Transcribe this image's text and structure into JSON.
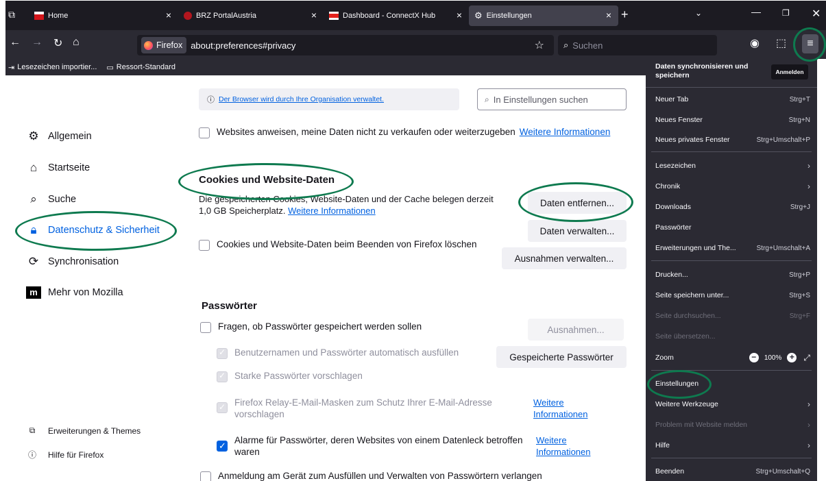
{
  "tabs": [
    {
      "title": "Home",
      "favicon_color": "#d4151a"
    },
    {
      "title": "BRZ PortalAustria",
      "favicon_color": "#b2161e"
    },
    {
      "title": "Dashboard - ConnectX Hub",
      "favicon_color": "#e2211c"
    },
    {
      "title": "Einstellungen",
      "favicon": "gear-icon",
      "active": true
    }
  ],
  "urlbar": {
    "identity": "Firefox",
    "url": "about:preferences#privacy"
  },
  "search": {
    "placeholder": "Suchen"
  },
  "bookmarks": [
    {
      "label": "Lesezeichen importier...",
      "icon": "import-icon"
    },
    {
      "label": "Ressort-Standard",
      "icon": "folder-icon"
    }
  ],
  "sidebar": {
    "items": [
      {
        "label": "Allgemein",
        "icon": "gear-icon"
      },
      {
        "label": "Startseite",
        "icon": "home-icon"
      },
      {
        "label": "Suche",
        "icon": "search-icon"
      },
      {
        "label": "Datenschutz & Sicherheit",
        "icon": "lock-icon",
        "selected": true
      },
      {
        "label": "Synchronisation",
        "icon": "sync-icon"
      },
      {
        "label": "Mehr von Mozilla",
        "icon": "mozilla-icon"
      }
    ],
    "footer": [
      {
        "label": "Erweiterungen & Themes",
        "icon": "puzzle-icon"
      },
      {
        "label": "Hilfe für Firefox",
        "icon": "help-icon"
      }
    ]
  },
  "main": {
    "notice": "Der Browser wird durch Ihre Organisation verwaltet.",
    "find_placeholder": "In Einstellungen suchen",
    "gpc": {
      "label": "Websites anweisen, meine Daten nicht zu verkaufen oder weiterzugeben",
      "link": "Weitere Informationen"
    },
    "cookies": {
      "heading": "Cookies und Website-Daten",
      "description": "Die gespeicherten Cookies, Website-Daten und der Cache belegen derzeit 1,0 GB Speicherplatz.",
      "link": "Weitere Informationen",
      "clear_button": "Daten entfernen...",
      "manage_button": "Daten verwalten...",
      "exceptions_button": "Ausnahmen verwalten...",
      "delete_on_close": "Cookies und Website-Daten beim Beenden von Firefox löschen"
    },
    "passwords": {
      "heading": "Passwörter",
      "ask_save": "Fragen, ob Passwörter gespeichert werden sollen",
      "exceptions_button": "Ausnahmen...",
      "autofill": "Benutzernamen und Passwörter automatisch ausfüllen",
      "saved_button": "Gespeicherte Passwörter",
      "suggest_strong": "Starke Passwörter vorschlagen",
      "relay": "Firefox Relay-E-Mail-Masken zum Schutz Ihrer E-Mail-Adresse vorschlagen",
      "relay_link": "Weitere Informationen",
      "breach": "Alarme für Passwörter, deren Websites von einem Datenleck betroffen waren",
      "breach_link": "Weitere Informationen",
      "device_auth": "Anmeldung am Gerät zum Ausfüllen und Verwalten von Passwörtern verlangen"
    }
  },
  "app_menu": {
    "sync_title": "Daten synchronisieren und speichern",
    "sign_in": "Anmelden",
    "items": [
      {
        "label": "Neuer Tab",
        "shortcut": "Strg+T"
      },
      {
        "label": "Neues Fenster",
        "shortcut": "Strg+N"
      },
      {
        "label": "Neues privates Fenster",
        "shortcut": "Strg+Umschalt+P"
      },
      {
        "label": "Lesezeichen",
        "arrow": true
      },
      {
        "label": "Chronik",
        "arrow": true
      },
      {
        "label": "Downloads",
        "shortcut": "Strg+J"
      },
      {
        "label": "Passwörter"
      },
      {
        "label": "Erweiterungen und The...",
        "shortcut": "Strg+Umschalt+A"
      },
      {
        "label": "Drucken...",
        "shortcut": "Strg+P"
      },
      {
        "label": "Seite speichern unter...",
        "shortcut": "Strg+S"
      },
      {
        "label": "Seite durchsuchen...",
        "shortcut": "Strg+F",
        "disabled": true
      },
      {
        "label": "Seite übersetzen...",
        "disabled": true
      },
      {
        "label": "Zoom",
        "zoom": "100%"
      },
      {
        "label": "Einstellungen"
      },
      {
        "label": "Weitere Werkzeuge",
        "arrow": true
      },
      {
        "label": "Problem mit Website melden",
        "arrow": true,
        "disabled": true
      },
      {
        "label": "Hilfe",
        "arrow": true
      },
      {
        "label": "Beenden",
        "shortcut": "Strg+Umschalt+Q"
      }
    ]
  },
  "colors": {
    "accent": "#0061e0",
    "highlight": "#0e7a4f",
    "menu_bg": "#2b2a33",
    "tab_bg": "#1c1b22"
  }
}
